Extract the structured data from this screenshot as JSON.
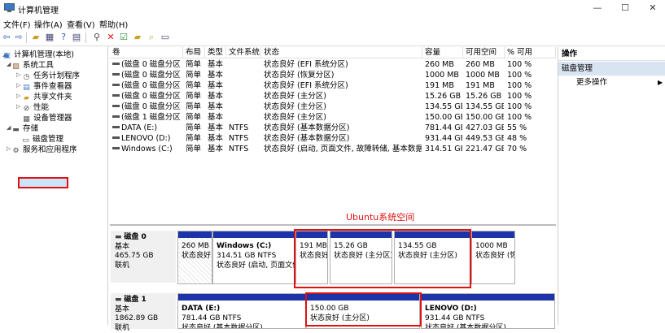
{
  "window": {
    "title": "计算机管理",
    "min": "—",
    "max": "☐",
    "close": "✕"
  },
  "menu": [
    "文件(F)",
    "操作(A)",
    "查看(V)",
    "帮助(H)"
  ],
  "tree": {
    "root": "计算机管理(本地)",
    "system_tools": "系统工具",
    "task_scheduler": "任务计划程序",
    "event_viewer": "事件查看器",
    "shared_folders": "共享文件夹",
    "performance": "性能",
    "device_manager": "设备管理器",
    "storage": "存储",
    "disk_management": "磁盘管理",
    "services": "服务和应用程序"
  },
  "volume_table": {
    "headers": [
      "卷",
      "布局",
      "类型",
      "文件系统",
      "状态",
      "容量",
      "可用空间",
      "% 可用"
    ],
    "rows": [
      [
        "(磁盘 0 磁盘分区 1)",
        "简单",
        "基本",
        "",
        "状态良好 (EFI 系统分区)",
        "260 MB",
        "260 MB",
        "100 %"
      ],
      [
        "(磁盘 0 磁盘分区 4)",
        "简单",
        "基本",
        "",
        "状态良好 (恢复分区)",
        "1000 MB",
        "1000 MB",
        "100 %"
      ],
      [
        "(磁盘 0 磁盘分区 5)",
        "简单",
        "基本",
        "",
        "状态良好 (EFI 系统分区)",
        "191 MB",
        "191 MB",
        "100 %"
      ],
      [
        "(磁盘 0 磁盘分区 6)",
        "简单",
        "基本",
        "",
        "状态良好 (主分区)",
        "15.26 GB",
        "15.26 GB",
        "100 %"
      ],
      [
        "(磁盘 0 磁盘分区 7)",
        "简单",
        "基本",
        "",
        "状态良好 (主分区)",
        "134.55 GB",
        "134.55 GB",
        "100 %"
      ],
      [
        "(磁盘 1 磁盘分区 2)",
        "简单",
        "基本",
        "",
        "状态良好 (主分区)",
        "150.00 GB",
        "150.00 GB",
        "100 %"
      ],
      [
        "DATA (E:)",
        "简单",
        "基本",
        "NTFS",
        "状态良好 (基本数据分区)",
        "781.44 GB",
        "427.03 GB",
        "55 %"
      ],
      [
        "LENOVO (D:)",
        "简单",
        "基本",
        "NTFS",
        "状态良好 (基本数据分区)",
        "931.44 GB",
        "449.53 GB",
        "48 %"
      ],
      [
        "Windows (C:)",
        "简单",
        "基本",
        "NTFS",
        "状态良好 (启动, 页面文件, 故障转储, 基本数据分区)",
        "314.51 GB",
        "221.47 GB",
        "70 %"
      ]
    ]
  },
  "annotation": "Ubuntu系统空间",
  "disks": [
    {
      "name": "磁盘 0",
      "type": "基本",
      "size": "465.75 GB",
      "status": "联机",
      "parts": [
        {
          "l1": "",
          "l2": "260 MB",
          "l3": "状态良好"
        },
        {
          "l1": "Windows  (C:)",
          "l2": "314.51 GB NTFS",
          "l3": "状态良好 (启动, 页面文件"
        },
        {
          "l1": "",
          "l2": "191 MB",
          "l3": "状态良好"
        },
        {
          "l1": "",
          "l2": "15.26 GB",
          "l3": "状态良好 (主分区)"
        },
        {
          "l1": "",
          "l2": "134.55 GB",
          "l3": "状态良好 (主分区)"
        },
        {
          "l1": "",
          "l2": "1000 MB",
          "l3": "状态良好 (恢"
        }
      ]
    },
    {
      "name": "磁盘 1",
      "type": "基本",
      "size": "1862.89 GB",
      "status": "联机",
      "parts": [
        {
          "l1": "DATA  (E:)",
          "l2": "781.44 GB NTFS",
          "l3": "状态良好 (基本数据分区)"
        },
        {
          "l1": "",
          "l2": "150.00 GB",
          "l3": "状态良好 (主分区)"
        },
        {
          "l1": "LENOVO  (D:)",
          "l2": "931.44 GB NTFS",
          "l3": "状态良好 (基本数据分区)"
        }
      ]
    }
  ],
  "actions": {
    "title": "操作",
    "section": "磁盘管理",
    "more": "更多操作"
  }
}
